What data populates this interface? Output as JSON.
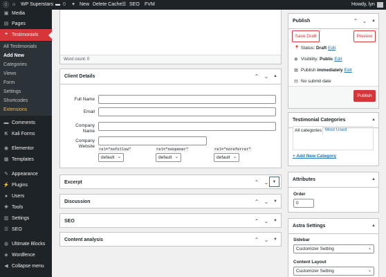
{
  "adminbar": {
    "site_name": "WP Superstars",
    "comments_count": "0",
    "new_label": "New",
    "delete_cache_label": "Delete Cache",
    "seo_label": "SEO",
    "fvm_label": "FVM",
    "greeting": "Howdy, lyn"
  },
  "menu": {
    "media": "Media",
    "pages": "Pages",
    "testimonials": "Testimonials",
    "submenu": [
      "All Testimonials",
      "Add New",
      "Categories",
      "Views",
      "Form",
      "Settings",
      "Shortcodes",
      "Extensions"
    ],
    "comments": "Comments",
    "kali_forms": "Kali Forms",
    "elementor": "Elementor",
    "templates": "Templates",
    "appearance": "Appearance",
    "plugins": "Plugins",
    "users": "Users",
    "tools": "Tools",
    "settings": "Settings",
    "seo": "SEO",
    "ultimate_blocks": "Ultimate Blocks",
    "wordfence": "Wordfence",
    "collapse": "Collapse menu"
  },
  "editor": {
    "word_count": "Word count: 0"
  },
  "client_details": {
    "title": "Client Details",
    "full_name_label": "Full Name",
    "email_label": "Email",
    "company_name_label": "Company Name",
    "company_website_label": "Company Website",
    "rel_options": [
      {
        "code": "rel=\"nofollow\"",
        "value": "default"
      },
      {
        "code": "rel=\"noopener\"",
        "value": "default"
      },
      {
        "code": "rel=\"noreferrer\"",
        "value": "default"
      }
    ]
  },
  "boxes": {
    "excerpt": "Excerpt",
    "discussion": "Discussion",
    "seo": "SEO",
    "content_analysis": "Content analysis"
  },
  "publish": {
    "title": "Publish",
    "save_draft": "Save Draft",
    "preview": "Preview",
    "status_label": "Status:",
    "status_value": "Draft",
    "visibility_label": "Visibility:",
    "visibility_value": "Public",
    "publish_label": "Publish",
    "publish_when": "immediately",
    "edit": "Edit",
    "no_submit": "No submit date",
    "publish_button": "Publish"
  },
  "categories": {
    "title": "Testimonial Categories",
    "tab_all": "All categories",
    "tab_most_used": "Most Used",
    "add_new": "+ Add New Category"
  },
  "attributes": {
    "title": "Attributes",
    "order_label": "Order",
    "order_value": "0"
  },
  "astra": {
    "title": "Astra Settings",
    "sidebar_label": "Sidebar",
    "sidebar_value": "Customizer Setting",
    "content_layout_label": "Content Layout",
    "content_layout_value": "Customizer Setting"
  },
  "colors": {
    "admin_dark": "#1d2327",
    "accent_red": "#d63638",
    "link_blue": "#2271b1"
  }
}
